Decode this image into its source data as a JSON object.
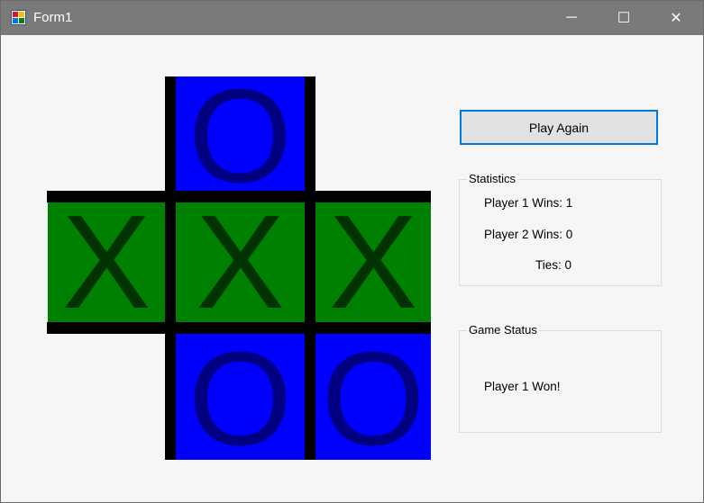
{
  "window": {
    "title": "Form1",
    "minimize_glyph": "─",
    "maximize_glyph": "☐",
    "close_glyph": "✕"
  },
  "board": {
    "colors": {
      "x_cell": "#008000",
      "o_cell": "#0000ff",
      "x_mark": "#003300",
      "o_mark": "#000080",
      "grid": "#000000"
    },
    "cells": [
      {
        "row": 0,
        "col": 0,
        "mark": ""
      },
      {
        "row": 0,
        "col": 1,
        "mark": "O"
      },
      {
        "row": 0,
        "col": 2,
        "mark": ""
      },
      {
        "row": 1,
        "col": 0,
        "mark": "X"
      },
      {
        "row": 1,
        "col": 1,
        "mark": "X"
      },
      {
        "row": 1,
        "col": 2,
        "mark": "X"
      },
      {
        "row": 2,
        "col": 0,
        "mark": ""
      },
      {
        "row": 2,
        "col": 1,
        "mark": "O"
      },
      {
        "row": 2,
        "col": 2,
        "mark": "O"
      }
    ]
  },
  "controls": {
    "play_again_label": "Play Again"
  },
  "statistics": {
    "title": "Statistics",
    "player1": "Player 1 Wins: 1",
    "player2": "Player 2 Wins: 0",
    "ties": "Ties: 0"
  },
  "game_status": {
    "title": "Game Status",
    "message": "Player 1 Won!"
  }
}
